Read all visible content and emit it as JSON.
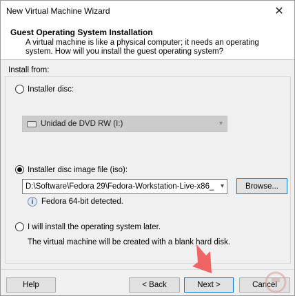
{
  "window": {
    "title": "New Virtual Machine Wizard",
    "close_glyph": "✕"
  },
  "header": {
    "title": "Guest Operating System Installation",
    "description": "A virtual machine is like a physical computer; it needs an operating system. How will you install the guest operating system?"
  },
  "install_from": {
    "label": "Install from:",
    "options": [
      {
        "label": "Installer disc:",
        "selected": false
      },
      {
        "label": "Installer disc image file (iso):",
        "selected": true
      },
      {
        "label": "I will install the operating system later.",
        "selected": false
      }
    ],
    "disc_drive": {
      "value": "Unidad de DVD RW (I:)",
      "icon": "dvd-drive-icon",
      "enabled": false
    },
    "iso_path": {
      "value": "D:\\Software\\Fedora 29\\Fedora-Workstation-Live-x86_"
    },
    "browse_label": "Browse...",
    "detected_text": "Fedora 64-bit detected.",
    "later_description": "The virtual machine will be created with a blank hard disk."
  },
  "footer": {
    "help_label": "Help",
    "back_label": "< Back",
    "next_label": "Next >",
    "cancel_label": "Cancel"
  },
  "colors": {
    "accent": "#0078d7",
    "arrow": "#f06464"
  }
}
